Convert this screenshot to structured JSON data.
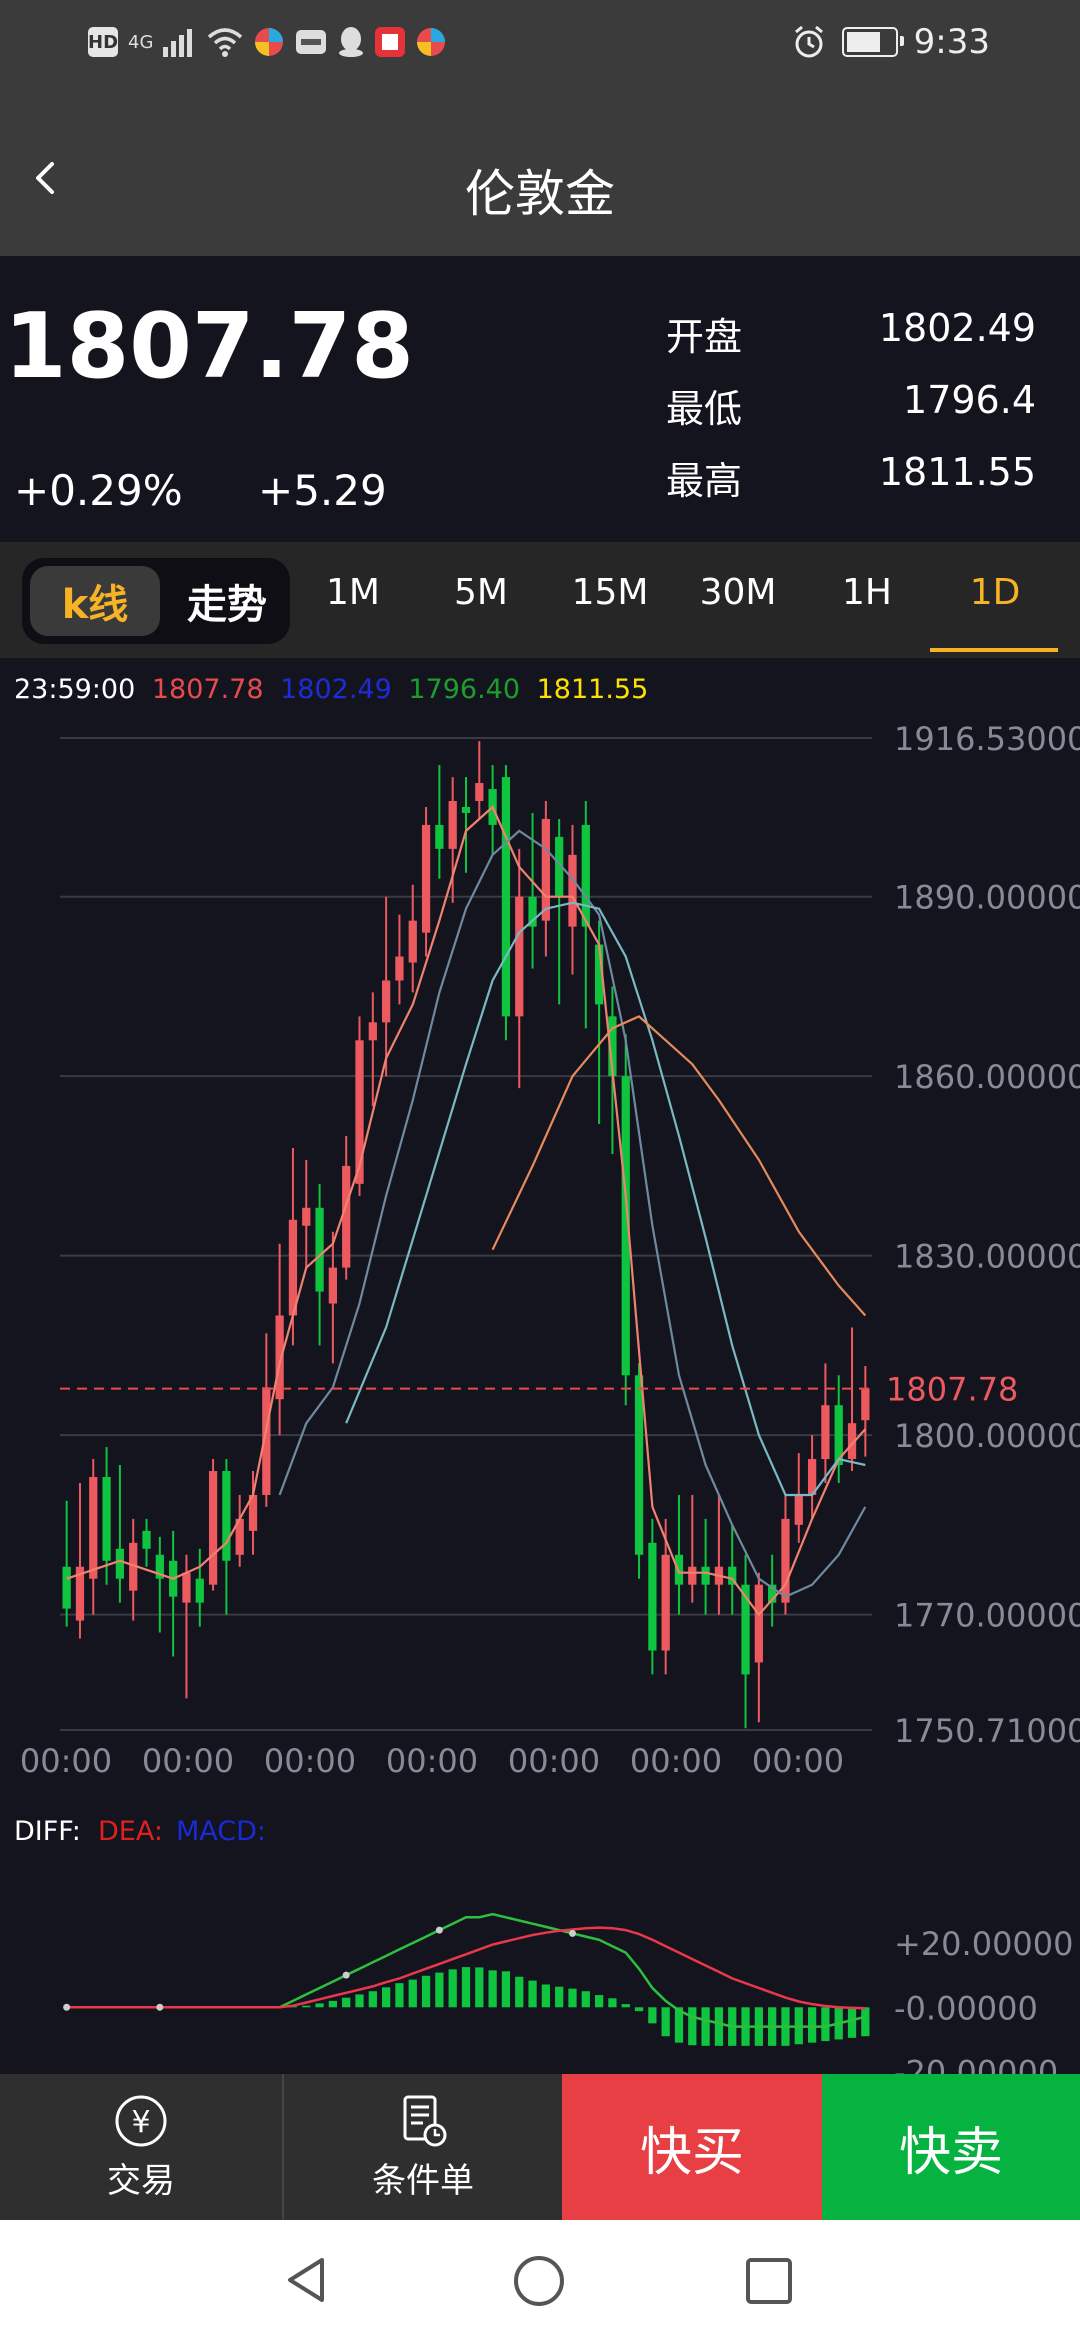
{
  "status_bar": {
    "left_badges": [
      "HD",
      "4G"
    ],
    "time": "9:33"
  },
  "header": {
    "title": "伦敦金"
  },
  "quote": {
    "price": "1807.78",
    "change_pct": "+0.29%",
    "change": "+5.29",
    "stats": [
      {
        "label": "开盘",
        "value": "1802.49"
      },
      {
        "label": "最低",
        "value": "1796.4"
      },
      {
        "label": "最高",
        "value": "1811.55"
      }
    ]
  },
  "tabs": {
    "segment": [
      "k线",
      "走势"
    ],
    "periods": [
      "1M",
      "5M",
      "15M",
      "30M",
      "1H",
      "1D"
    ],
    "active_period": "1D"
  },
  "chart_data": {
    "type": "candlestick",
    "info_line": {
      "time": "23:59:00",
      "close": "1807.78",
      "open": "1802.49",
      "low": "1796.40",
      "high": "1811.55"
    },
    "info_colors": {
      "time": "#ffffff",
      "close": "#e84b4b",
      "open": "#1f2bd6",
      "low": "#1e9c2e",
      "high": "#ffe000"
    },
    "y_tick_labels": [
      "1916.53000",
      "1890.00000",
      "1860.00000",
      "1830.00000",
      "1800.00000",
      "1770.00000",
      "1750.71000"
    ],
    "y_ticks": [
      1916.53,
      1890,
      1860,
      1830,
      1800,
      1770,
      1750.71
    ],
    "ylim": [
      1750.71,
      1916.53
    ],
    "x_tick_labels": [
      "00:00",
      "00:00",
      "00:00",
      "00:00",
      "00:00",
      "00:00",
      "00:00"
    ],
    "current_price_label": "1807.78",
    "current_price": 1807.78,
    "candles": [
      {
        "o": 1778,
        "c": 1771,
        "h": 1789,
        "l": 1768
      },
      {
        "o": 1769,
        "c": 1778,
        "h": 1792,
        "l": 1766
      },
      {
        "o": 1776,
        "c": 1793,
        "h": 1796,
        "l": 1770
      },
      {
        "o": 1793,
        "c": 1779,
        "h": 1798,
        "l": 1775
      },
      {
        "o": 1781,
        "c": 1776,
        "h": 1795,
        "l": 1772
      },
      {
        "o": 1774,
        "c": 1782,
        "h": 1786,
        "l": 1769
      },
      {
        "o": 1784,
        "c": 1781,
        "h": 1786,
        "l": 1778
      },
      {
        "o": 1780,
        "c": 1776,
        "h": 1783,
        "l": 1767
      },
      {
        "o": 1779,
        "c": 1773,
        "h": 1784,
        "l": 1763
      },
      {
        "o": 1772,
        "c": 1777,
        "h": 1780,
        "l": 1756
      },
      {
        "o": 1776,
        "c": 1772,
        "h": 1781,
        "l": 1768
      },
      {
        "o": 1775,
        "c": 1794,
        "h": 1796,
        "l": 1774
      },
      {
        "o": 1794,
        "c": 1779,
        "h": 1796,
        "l": 1770
      },
      {
        "o": 1780,
        "c": 1786,
        "h": 1790,
        "l": 1778
      },
      {
        "o": 1784,
        "c": 1790,
        "h": 1794,
        "l": 1780
      },
      {
        "o": 1790,
        "c": 1808,
        "h": 1817,
        "l": 1788
      },
      {
        "o": 1806,
        "c": 1820,
        "h": 1832,
        "l": 1800
      },
      {
        "o": 1820,
        "c": 1836,
        "h": 1848,
        "l": 1815
      },
      {
        "o": 1835,
        "c": 1838,
        "h": 1846,
        "l": 1828
      },
      {
        "o": 1838,
        "c": 1824,
        "h": 1842,
        "l": 1815
      },
      {
        "o": 1822,
        "c": 1828,
        "h": 1834,
        "l": 1812
      },
      {
        "o": 1828,
        "c": 1845,
        "h": 1850,
        "l": 1826
      },
      {
        "o": 1842,
        "c": 1866,
        "h": 1870,
        "l": 1840
      },
      {
        "o": 1866,
        "c": 1869,
        "h": 1874,
        "l": 1855
      },
      {
        "o": 1869,
        "c": 1876,
        "h": 1890,
        "l": 1860
      },
      {
        "o": 1876,
        "c": 1880,
        "h": 1887,
        "l": 1872
      },
      {
        "o": 1879,
        "c": 1886,
        "h": 1892,
        "l": 1874
      },
      {
        "o": 1884,
        "c": 1902,
        "h": 1905,
        "l": 1880
      },
      {
        "o": 1902,
        "c": 1898,
        "h": 1912,
        "l": 1893
      },
      {
        "o": 1898,
        "c": 1906,
        "h": 1910,
        "l": 1889
      },
      {
        "o": 1905,
        "c": 1904,
        "h": 1910,
        "l": 1894
      },
      {
        "o": 1906,
        "c": 1909,
        "h": 1916,
        "l": 1903
      },
      {
        "o": 1908,
        "c": 1902,
        "h": 1912,
        "l": 1897
      },
      {
        "o": 1910,
        "c": 1870,
        "h": 1912,
        "l": 1866
      },
      {
        "o": 1870,
        "c": 1890,
        "h": 1898,
        "l": 1858
      },
      {
        "o": 1890,
        "c": 1885,
        "h": 1904,
        "l": 1878
      },
      {
        "o": 1886,
        "c": 1903,
        "h": 1906,
        "l": 1880
      },
      {
        "o": 1900,
        "c": 1890,
        "h": 1903,
        "l": 1872
      },
      {
        "o": 1885,
        "c": 1897,
        "h": 1902,
        "l": 1877
      },
      {
        "o": 1902,
        "c": 1885,
        "h": 1906,
        "l": 1868
      },
      {
        "o": 1882,
        "c": 1872,
        "h": 1886,
        "l": 1852
      },
      {
        "o": 1870,
        "c": 1860,
        "h": 1875,
        "l": 1847
      },
      {
        "o": 1860,
        "c": 1810,
        "h": 1867,
        "l": 1805
      },
      {
        "o": 1810,
        "c": 1780,
        "h": 1812,
        "l": 1776
      },
      {
        "o": 1782,
        "c": 1764,
        "h": 1786,
        "l": 1760
      },
      {
        "o": 1764,
        "c": 1780,
        "h": 1786,
        "l": 1760
      },
      {
        "o": 1780,
        "c": 1775,
        "h": 1790,
        "l": 1770
      },
      {
        "o": 1775,
        "c": 1778,
        "h": 1790,
        "l": 1772
      },
      {
        "o": 1778,
        "c": 1775,
        "h": 1786,
        "l": 1770
      },
      {
        "o": 1775,
        "c": 1778,
        "h": 1790,
        "l": 1770
      },
      {
        "o": 1778,
        "c": 1775,
        "h": 1785,
        "l": 1770
      },
      {
        "o": 1775,
        "c": 1760,
        "h": 1780,
        "l": 1751
      },
      {
        "o": 1762,
        "c": 1775,
        "h": 1777,
        "l": 1752
      },
      {
        "o": 1775,
        "c": 1772,
        "h": 1780,
        "l": 1768
      },
      {
        "o": 1772,
        "c": 1786,
        "h": 1790,
        "l": 1770
      },
      {
        "o": 1785,
        "c": 1790,
        "h": 1797,
        "l": 1782
      },
      {
        "o": 1790,
        "c": 1796,
        "h": 1800,
        "l": 1786
      },
      {
        "o": 1796,
        "c": 1805,
        "h": 1812,
        "l": 1792
      },
      {
        "o": 1805,
        "c": 1795,
        "h": 1810,
        "l": 1792
      },
      {
        "o": 1796,
        "c": 1802,
        "h": 1818,
        "l": 1794
      },
      {
        "o": 1802.49,
        "c": 1807.78,
        "h": 1811.55,
        "l": 1796.4
      }
    ],
    "ma_lines": [
      {
        "color": "#f08270",
        "points": [
          [
            0,
            1776
          ],
          [
            4,
            1779
          ],
          [
            8,
            1776
          ],
          [
            10,
            1778
          ],
          [
            12,
            1782
          ],
          [
            14,
            1790
          ],
          [
            16,
            1812
          ],
          [
            18,
            1828
          ],
          [
            20,
            1832
          ],
          [
            22,
            1845
          ],
          [
            24,
            1863
          ],
          [
            26,
            1872
          ],
          [
            28,
            1886
          ],
          [
            30,
            1901
          ],
          [
            32,
            1905
          ],
          [
            34,
            1895
          ],
          [
            36,
            1890
          ],
          [
            38,
            1890
          ],
          [
            40,
            1882
          ],
          [
            42,
            1840
          ],
          [
            44,
            1788
          ],
          [
            46,
            1777
          ],
          [
            48,
            1777
          ],
          [
            50,
            1776
          ],
          [
            52,
            1770
          ],
          [
            54,
            1775
          ],
          [
            56,
            1786
          ],
          [
            58,
            1796
          ],
          [
            60,
            1801
          ]
        ]
      },
      {
        "color": "#6e8aa0",
        "points": [
          [
            16,
            1790
          ],
          [
            18,
            1802
          ],
          [
            20,
            1808
          ],
          [
            22,
            1822
          ],
          [
            24,
            1840
          ],
          [
            26,
            1856
          ],
          [
            28,
            1874
          ],
          [
            30,
            1888
          ],
          [
            32,
            1897
          ],
          [
            34,
            1901
          ],
          [
            36,
            1898
          ],
          [
            38,
            1893
          ],
          [
            40,
            1887
          ],
          [
            42,
            1866
          ],
          [
            44,
            1835
          ],
          [
            46,
            1810
          ],
          [
            48,
            1795
          ],
          [
            50,
            1785
          ],
          [
            52,
            1776
          ],
          [
            54,
            1773
          ],
          [
            56,
            1775
          ],
          [
            58,
            1780
          ],
          [
            60,
            1788
          ]
        ]
      },
      {
        "color": "#7ab8c4",
        "points": [
          [
            21,
            1802
          ],
          [
            24,
            1818
          ],
          [
            27,
            1840
          ],
          [
            30,
            1862
          ],
          [
            32,
            1876
          ],
          [
            34,
            1884
          ],
          [
            36,
            1888
          ],
          [
            38,
            1889
          ],
          [
            40,
            1888
          ],
          [
            42,
            1880
          ],
          [
            44,
            1866
          ],
          [
            46,
            1850
          ],
          [
            48,
            1833
          ],
          [
            50,
            1815
          ],
          [
            52,
            1800
          ],
          [
            54,
            1790
          ],
          [
            56,
            1790
          ],
          [
            58,
            1796
          ],
          [
            60,
            1795
          ]
        ]
      },
      {
        "color": "#e88a5a",
        "points": [
          [
            32,
            1831
          ],
          [
            35,
            1845
          ],
          [
            38,
            1860
          ],
          [
            41,
            1868
          ],
          [
            43,
            1870
          ],
          [
            45,
            1866
          ],
          [
            47,
            1862
          ],
          [
            49,
            1856
          ],
          [
            52,
            1846
          ],
          [
            55,
            1834
          ],
          [
            58,
            1825
          ],
          [
            60,
            1820
          ]
        ]
      }
    ],
    "macd": {
      "header": {
        "diff": "DIFF:",
        "dea": "DEA:",
        "macd": "MACD:"
      },
      "header_colors": {
        "diff": "#ffffff",
        "dea": "#e02020",
        "macd": "#1a2ad8"
      },
      "y_tick_labels": [
        "+20.00000",
        "-0.00000",
        "-20.00000"
      ],
      "y_ticks": [
        20,
        0,
        -20
      ],
      "ylim": [
        -22,
        34
      ],
      "hist": [
        0,
        0,
        0,
        0,
        0,
        0,
        0,
        0,
        0,
        0,
        0,
        0,
        0,
        0,
        0,
        0,
        0,
        0.3,
        0.5,
        1.2,
        2.0,
        3.0,
        4.0,
        5.0,
        6.2,
        7.5,
        8.6,
        9.8,
        10.8,
        11.8,
        12.5,
        12.4,
        11.5,
        11.2,
        9.5,
        8.3,
        7.1,
        6.4,
        5.8,
        5.0,
        3.8,
        2.8,
        1.0,
        -1.2,
        -5,
        -9,
        -11,
        -11.8,
        -12,
        -12,
        -12,
        -12,
        -12,
        -12,
        -12,
        -11.5,
        -11,
        -10.5,
        -10,
        -9.5,
        -9
      ],
      "diff": [
        0,
        0,
        0,
        0,
        0,
        0,
        0,
        0,
        0,
        0,
        0,
        0,
        0,
        0,
        0,
        0,
        0,
        2,
        4,
        6,
        8,
        10,
        12,
        14,
        16,
        18,
        20,
        22,
        24,
        26,
        28,
        28,
        29,
        28,
        27,
        26,
        25,
        24,
        23,
        22,
        21,
        19,
        17,
        12,
        6,
        2,
        -1,
        -3,
        -4,
        -5,
        -6,
        -6,
        -6,
        -6,
        -6,
        -6,
        -6,
        -6,
        -5,
        -4,
        -3
      ],
      "dea": [
        0,
        0,
        0,
        0,
        0,
        0,
        0,
        0,
        0,
        0,
        0,
        0,
        0,
        0,
        0,
        0,
        0,
        0.5,
        1.5,
        2.5,
        3.5,
        4.5,
        5.5,
        6.5,
        7.8,
        9,
        10.5,
        12,
        13.5,
        15,
        16.5,
        18,
        19.5,
        20.5,
        21.5,
        22.5,
        23.2,
        23.8,
        24.2,
        24.6,
        24.8,
        24.6,
        24,
        22.8,
        21,
        19,
        17,
        15,
        13,
        11,
        9,
        7.5,
        6,
        4.5,
        3,
        1.8,
        1,
        0.4,
        0,
        -0.2,
        -0.3
      ]
    },
    "up_color": "#ec5a60",
    "down_color": "#0fc43f"
  },
  "bottom_bar": {
    "trade_label": "交易",
    "trade_icon_char": "¥",
    "condition_label": "条件单",
    "buy_label": "快买",
    "sell_label": "快卖"
  }
}
